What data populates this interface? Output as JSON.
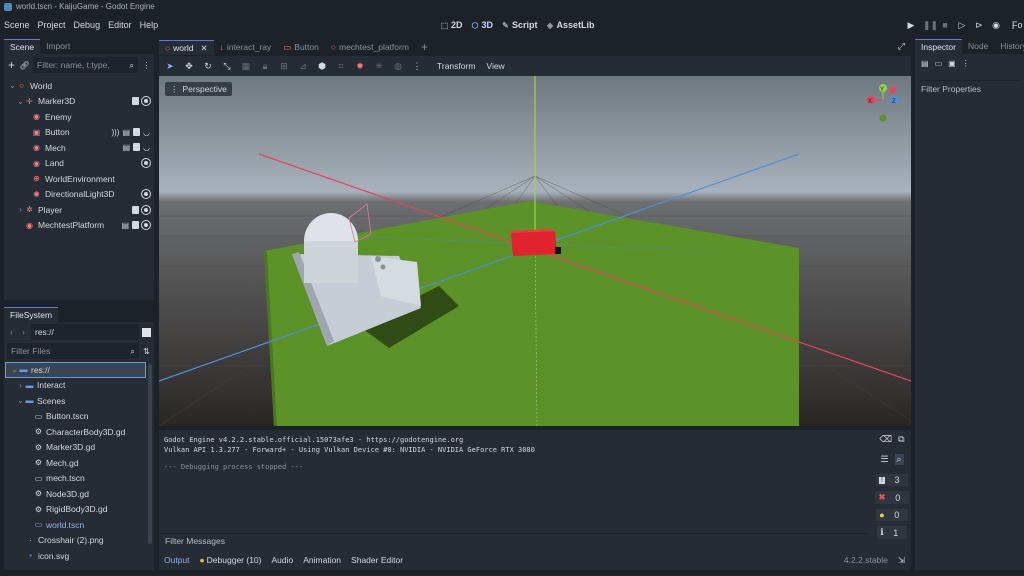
{
  "window": {
    "title": "world.tscn - KaijuGame - Godot Engine"
  },
  "menu": {
    "items": [
      "Scene",
      "Project",
      "Debug",
      "Editor",
      "Help"
    ]
  },
  "modes": {
    "m2d": "2D",
    "m3d": "3D",
    "script": "Script",
    "assetlib": "AssetLib"
  },
  "scene_dock": {
    "tabs": [
      "Scene",
      "Import"
    ],
    "filter_placeholder": "Filter: name, t:type,",
    "tree": [
      {
        "label": "World",
        "icon": "node3d-icon",
        "depth": 0
      },
      {
        "label": "Marker3D",
        "icon": "marker3d-icon",
        "depth": 1
      },
      {
        "label": "Enemy",
        "icon": "scene-instance-icon",
        "depth": 2
      },
      {
        "label": "Button",
        "icon": "button-icon",
        "depth": 2
      },
      {
        "label": "Mech",
        "icon": "scene-instance-icon",
        "depth": 2
      },
      {
        "label": "Land",
        "icon": "scene-instance-icon",
        "depth": 2
      },
      {
        "label": "WorldEnvironment",
        "icon": "world-environment-icon",
        "depth": 2
      },
      {
        "label": "DirectionalLight3D",
        "icon": "light-icon",
        "depth": 2
      },
      {
        "label": "Player",
        "icon": "player-icon",
        "depth": 1
      },
      {
        "label": "MechtestPlatform",
        "icon": "scene-instance-icon",
        "depth": 1
      }
    ]
  },
  "filesystem": {
    "tab": "FileSystem",
    "path": "res://",
    "filter_placeholder": "Filter Files",
    "items": [
      {
        "label": "res://",
        "type": "folder",
        "depth": 0,
        "selected": true
      },
      {
        "label": "Interact",
        "type": "folder",
        "depth": 1
      },
      {
        "label": "Scenes",
        "type": "folder",
        "depth": 1
      },
      {
        "label": "Button.tscn",
        "type": "scene",
        "depth": 2
      },
      {
        "label": "CharacterBody3D.gd",
        "type": "script",
        "depth": 2
      },
      {
        "label": "Marker3D.gd",
        "type": "script",
        "depth": 2
      },
      {
        "label": "Mech.gd",
        "type": "script",
        "depth": 2
      },
      {
        "label": "mech.tscn",
        "type": "scene",
        "depth": 2
      },
      {
        "label": "Node3D.gd",
        "type": "script",
        "depth": 2
      },
      {
        "label": "RigidBody3D.gd",
        "type": "script",
        "depth": 2
      },
      {
        "label": "world.tscn",
        "type": "scene",
        "depth": 2,
        "highlight": true
      },
      {
        "label": "Crosshair (2).png",
        "type": "image",
        "depth": 1
      },
      {
        "label": "icon.svg",
        "type": "image",
        "depth": 1
      }
    ]
  },
  "editor_tabs": [
    "world",
    "interact_ray",
    "Button",
    "mechtest_platform"
  ],
  "viewport_toolbar": {
    "transform": "Transform",
    "view": "View"
  },
  "viewport": {
    "perspective_label": "Perspective",
    "gizmo": {
      "y": "Y",
      "x": "X",
      "z": "Z"
    }
  },
  "output": {
    "lines": [
      "Godot Engine v4.2.2.stable.official.15073afe3 - https://godotengine.org",
      "Vulkan API 1.3.277 - Forward+ - Using Vulkan Device #0: NVIDIA - NVIDIA GeForce RTX 3080",
      "",
      "--- Debugging process stopped ---"
    ],
    "filter_placeholder": "Filter Messages",
    "counts": {
      "messages": "3",
      "errors": "0",
      "warnings": "0",
      "info": "1"
    }
  },
  "bottom_tabs": [
    "Output",
    "Debugger (10)",
    "Audio",
    "Animation",
    "Shader Editor"
  ],
  "version": "4.2.2.stable",
  "inspector": {
    "tabs": [
      "Inspector",
      "Node",
      "History"
    ],
    "filter_placeholder": "Filter Properties",
    "partial_label": "Fo"
  },
  "colors": {
    "accent": "#699ce8",
    "bg": "#1d2229",
    "panel": "#262c34",
    "floor": "#5c9227",
    "red_box": "#e0232e"
  }
}
